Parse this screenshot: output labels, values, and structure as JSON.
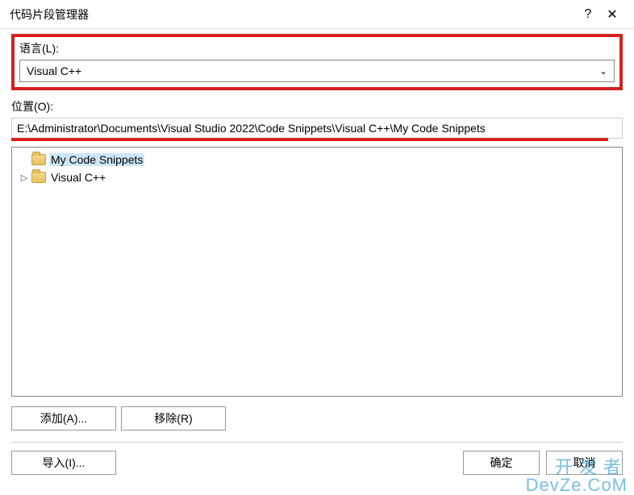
{
  "titlebar": {
    "title": "代码片段管理器",
    "help": "?",
    "close": "✕"
  },
  "language": {
    "label": "语言(L):",
    "selected": "Visual C++"
  },
  "location": {
    "label": "位置(O):",
    "value": "E:\\Administrator\\Documents\\Visual Studio 2022\\Code Snippets\\Visual C++\\My Code Snippets"
  },
  "tree": {
    "items": [
      {
        "label": "My Code Snippets",
        "expandable": false,
        "selected": true
      },
      {
        "label": "Visual C++",
        "expandable": true,
        "selected": false
      }
    ]
  },
  "buttons": {
    "add": "添加(A)...",
    "remove": "移除(R)",
    "import": "导入(I)...",
    "ok": "确定",
    "cancel": "取消"
  },
  "watermark": {
    "line1": "开发者",
    "line2": "DevZe.CoM"
  }
}
